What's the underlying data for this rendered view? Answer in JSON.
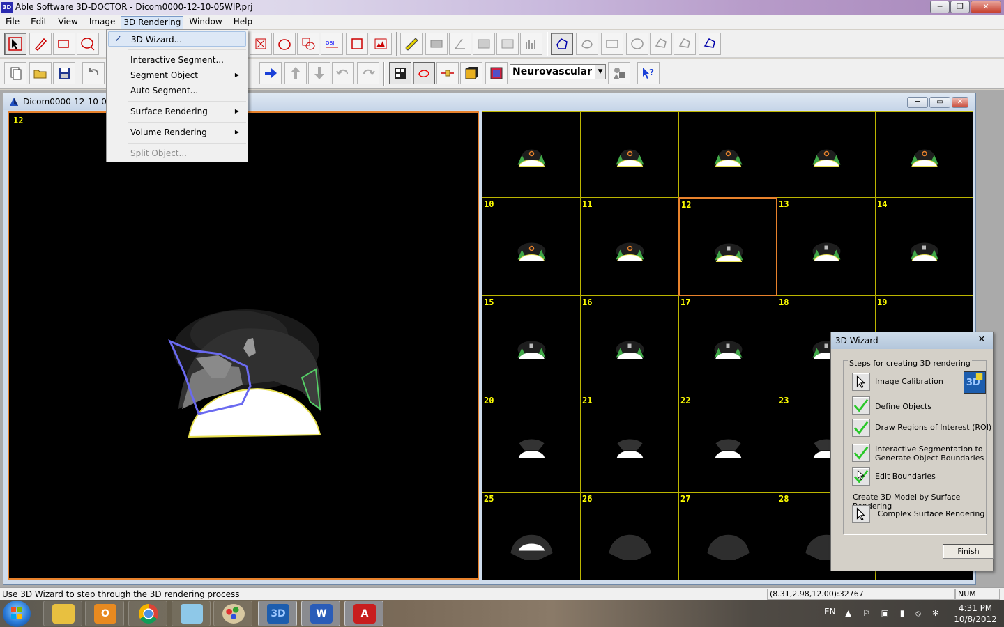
{
  "window": {
    "app_icon": "3D",
    "title": "Able Software 3D-DOCTOR - Dicom0000-12-10-05WIP.prj",
    "minimize": "─",
    "maximize": "❐",
    "close": "✕"
  },
  "menubar": {
    "items": [
      "File",
      "Edit",
      "View",
      "Image",
      "3D Rendering",
      "Window",
      "Help"
    ],
    "active": "3D Rendering"
  },
  "dropdown": {
    "checkmark": "✓",
    "submenu_arrow": "▶",
    "items": [
      {
        "label": "3D Wizard...",
        "checked": true,
        "submenu": false,
        "disabled": false
      },
      {
        "label": "Interactive Segment...",
        "checked": false,
        "submenu": false,
        "disabled": false
      },
      {
        "label": "Segment Object",
        "checked": false,
        "submenu": true,
        "disabled": false
      },
      {
        "label": "Auto Segment...",
        "checked": false,
        "submenu": false,
        "disabled": false
      },
      {
        "label": "Surface Rendering",
        "checked": false,
        "submenu": true,
        "disabled": false
      },
      {
        "label": "Volume Rendering",
        "checked": false,
        "submenu": true,
        "disabled": false
      },
      {
        "label": "Split Object...",
        "checked": false,
        "submenu": false,
        "disabled": true
      }
    ]
  },
  "toolbar": {
    "object_combo": "Neurovascular Bu",
    "combo_arrow": "▼"
  },
  "child_window": {
    "title": "Dicom0000-12-10-05W",
    "btn_min": "─",
    "btn_max": "▭",
    "btn_close": "✕"
  },
  "main_view": {
    "slice_number": "12"
  },
  "grid": {
    "labels": [
      "",
      "",
      "",
      "",
      "",
      "10",
      "11",
      "12",
      "13",
      "14",
      "15",
      "16",
      "17",
      "18",
      "19",
      "20",
      "21",
      "22",
      "23",
      "",
      "25",
      "26",
      "27",
      "28",
      ""
    ],
    "selected": "12"
  },
  "wizard": {
    "title": "3D Wizard",
    "close": "✕",
    "group_label": "Steps for creating 3D rendering",
    "logo": "3D",
    "steps": [
      {
        "label": "Image Calibration",
        "icon": "arrow-cursor-icon"
      },
      {
        "label": "Define Objects",
        "icon": "green-check-icon"
      },
      {
        "label": "Draw Regions of Interest (ROI)",
        "icon": "green-check-icon"
      },
      {
        "label": "Interactive Segmentation to Generate Object Boundaries",
        "icon": "green-check-icon"
      },
      {
        "label": "Edit Boundaries",
        "icon": "green-check-icon"
      }
    ],
    "section2": "Create 3D Model by Surface Rendering",
    "complex": "Complex Surface Rendering",
    "finish": "Finish"
  },
  "statusbar": {
    "message": "Use 3D Wizard to step through the 3D rendering process",
    "coords": "(8.31,2.98,12.00):32767",
    "num": "NUM"
  },
  "taskbar": {
    "lang": "EN",
    "tray_icons": "▲ ⚐ ▣ ▮ ⦸ ✻",
    "time": "4:31 PM",
    "date": "10/8/2012",
    "apps": [
      {
        "name": "explorer",
        "label": ""
      },
      {
        "name": "outlook",
        "label": "O"
      },
      {
        "name": "chrome",
        "label": ""
      },
      {
        "name": "notepad",
        "label": ""
      },
      {
        "name": "paint",
        "label": ""
      },
      {
        "name": "3d-doctor",
        "label": "3D"
      },
      {
        "name": "word",
        "label": "W"
      },
      {
        "name": "acrobat",
        "label": "A"
      }
    ]
  },
  "colors": {
    "selection_border": "#e8822c",
    "grid_line": "#bcb500",
    "slice_label": "#ffff00",
    "roi_outline": "#6a6af0",
    "check_green": "#28c828"
  }
}
